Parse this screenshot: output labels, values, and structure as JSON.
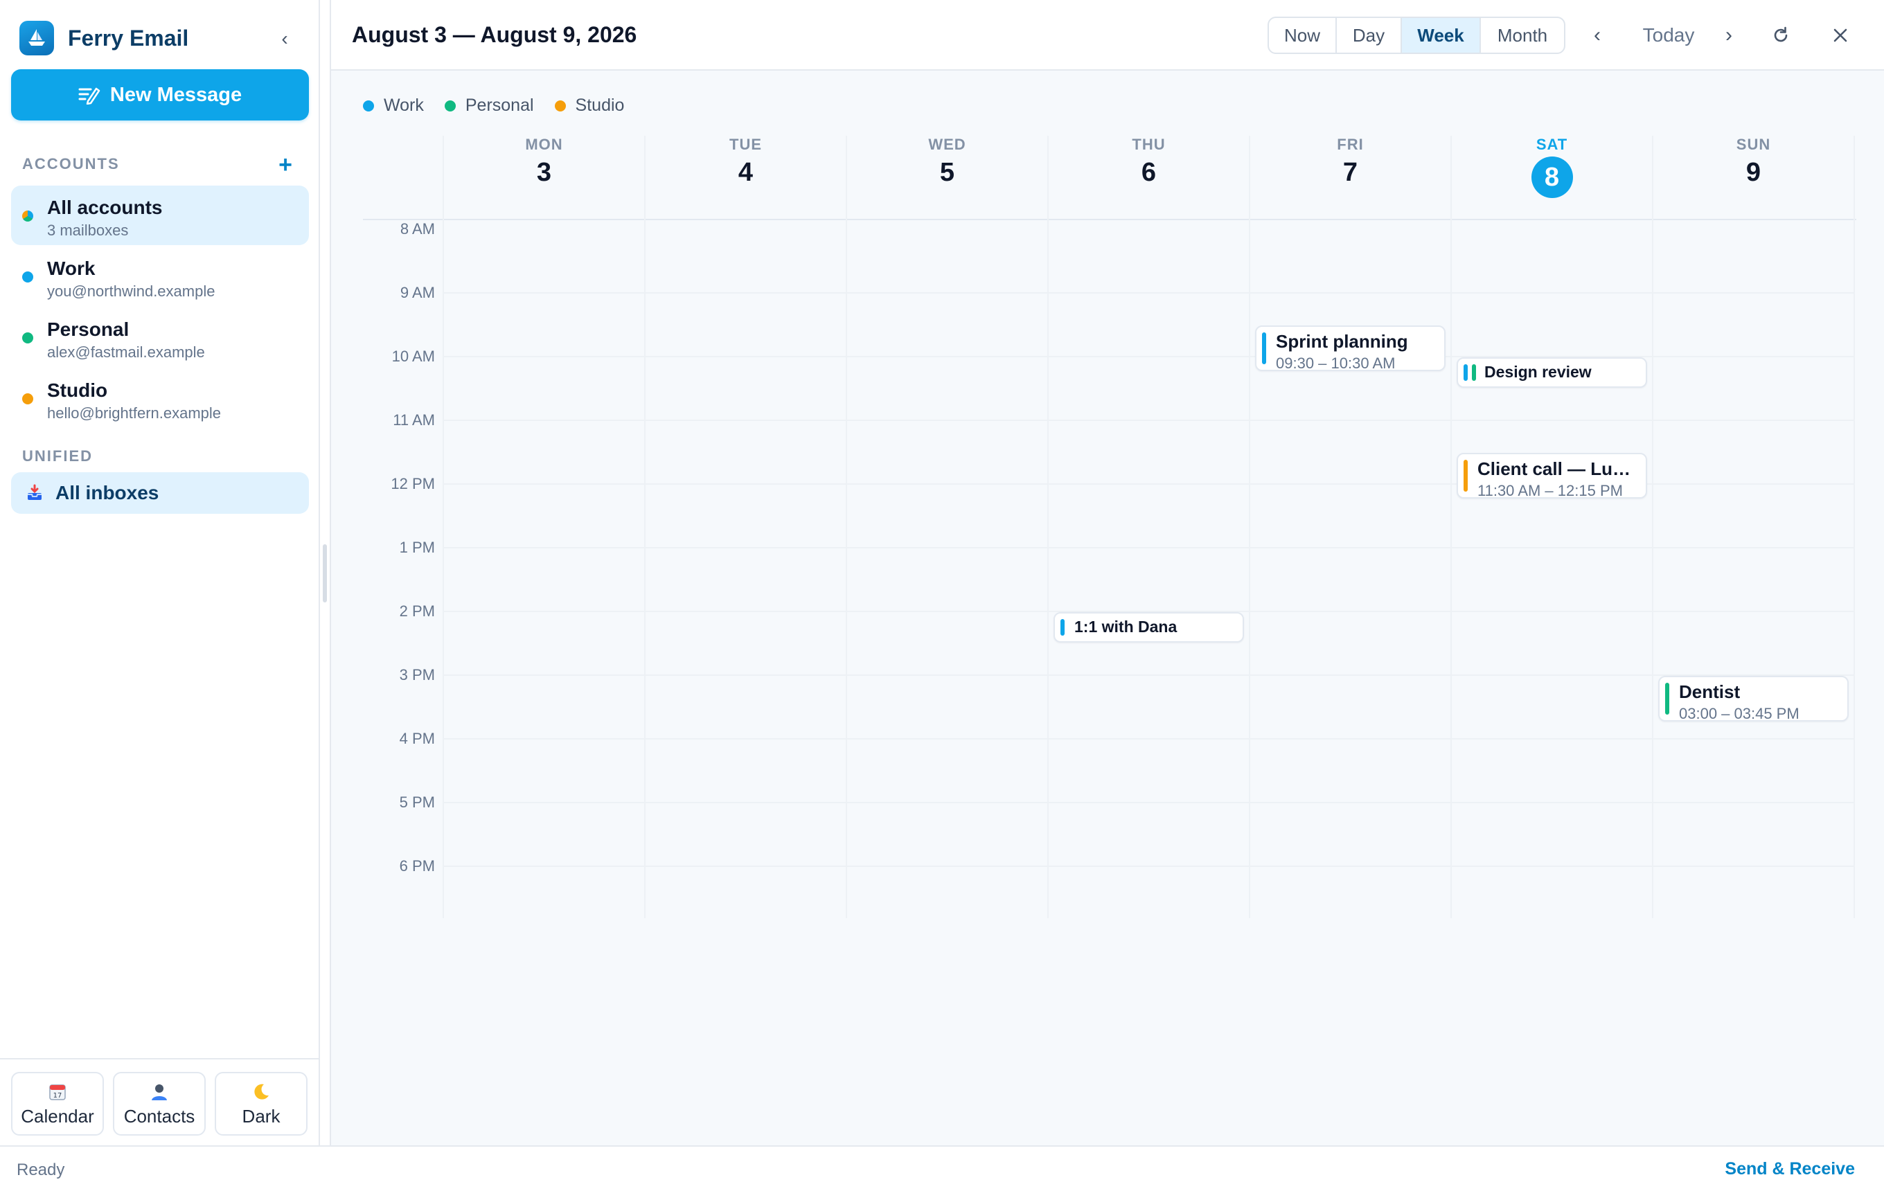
{
  "app": {
    "name": "Ferry Email"
  },
  "sidebar": {
    "new_message_label": "New Message",
    "accounts_label": "ACCOUNTS",
    "add_label": "+",
    "accounts": [
      {
        "name": "All accounts",
        "sub": "3 mailboxes",
        "color": "multi",
        "active": true
      },
      {
        "name": "Work",
        "sub": "you@northwind.example",
        "color": "#0ea5e9",
        "active": false
      },
      {
        "name": "Personal",
        "sub": "alex@fastmail.example",
        "color": "#10b981",
        "active": false
      },
      {
        "name": "Studio",
        "sub": "hello@brightfern.example",
        "color": "#f59e0b",
        "active": false
      }
    ],
    "unified_label": "UNIFIED",
    "all_inboxes_label": "All inboxes",
    "footer": [
      {
        "icon": "calendar-icon",
        "label": "Calendar"
      },
      {
        "icon": "contacts-icon",
        "label": "Contacts"
      },
      {
        "icon": "moon-icon",
        "label": "Dark"
      }
    ]
  },
  "calendar": {
    "range_title": "August 3 — August 9, 2026",
    "views": [
      "Now",
      "Day",
      "Week",
      "Month"
    ],
    "active_view": "Week",
    "today_label": "Today",
    "legend": [
      {
        "label": "Work",
        "color": "#0ea5e9"
      },
      {
        "label": "Personal",
        "color": "#10b981"
      },
      {
        "label": "Studio",
        "color": "#f59e0b"
      }
    ],
    "days": [
      {
        "dow": "MON",
        "num": "3",
        "today": false
      },
      {
        "dow": "TUE",
        "num": "4",
        "today": false
      },
      {
        "dow": "WED",
        "num": "5",
        "today": false
      },
      {
        "dow": "THU",
        "num": "6",
        "today": false
      },
      {
        "dow": "FRI",
        "num": "7",
        "today": false
      },
      {
        "dow": "SAT",
        "num": "8",
        "today": true
      },
      {
        "dow": "SUN",
        "num": "9",
        "today": false
      }
    ],
    "hours": [
      "8 AM",
      "9 AM",
      "10 AM",
      "11 AM",
      "12 PM",
      "1 PM",
      "2 PM",
      "3 PM",
      "4 PM",
      "5 PM",
      "6 PM"
    ],
    "events": [
      {
        "title": "Sprint planning",
        "time": "09:30 – 10:30 AM",
        "day": 4,
        "start": 9.5,
        "end": 10.5,
        "colors": [
          "#0ea5e9"
        ]
      },
      {
        "title": "Design review",
        "time": "",
        "day": 5,
        "start": 10.0,
        "end": 10.5,
        "colors": [
          "#0ea5e9",
          "#10b981"
        ]
      },
      {
        "title": "Client call — Lum...",
        "time": "11:30 AM – 12:15 PM",
        "day": 5,
        "start": 11.5,
        "end": 12.25,
        "colors": [
          "#f59e0b"
        ]
      },
      {
        "title": "1:1 with Dana",
        "time": "",
        "day": 3,
        "start": 14.0,
        "end": 14.5,
        "colors": [
          "#0ea5e9"
        ]
      },
      {
        "title": "Dentist",
        "time": "03:00 – 03:45 PM",
        "day": 6,
        "start": 15.0,
        "end": 15.75,
        "colors": [
          "#10b981"
        ]
      }
    ]
  },
  "status": {
    "text": "Ready",
    "send_receive_label": "Send & Receive"
  }
}
